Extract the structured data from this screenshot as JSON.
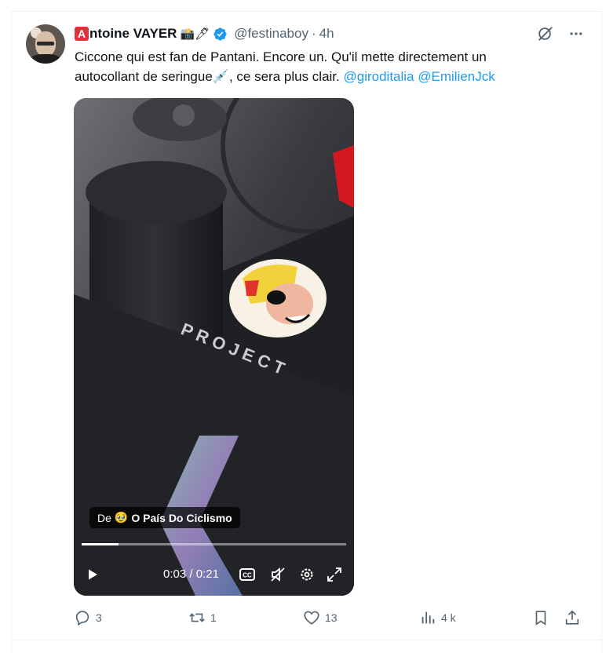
{
  "author": {
    "badge_letter": "A",
    "name": "ntoine VAYER",
    "name_emojis": "📸🖊",
    "handle": "@festinaboy",
    "separator": "·",
    "time": "4h",
    "verified_color": "#1d9bf0"
  },
  "tweet": {
    "text_line1": "Ciccone qui est fan de Pantani. Encore un. Qu'il mette directement un",
    "text_line2": "autocollant de seringue",
    "syringe_emoji": "💉",
    "text_line2_after": ", ce sera plus clair.",
    "mention1": "@giroditalia",
    "mention2": "@EmilienJck"
  },
  "media": {
    "frame_text": "P R O J E C T",
    "source_prefix": "De",
    "source_emoji": "🥹",
    "source_name": "O País Do Ciclismo",
    "progress_fraction": 0.14,
    "current_time": "0:03",
    "time_separator": "/",
    "duration": "0:21"
  },
  "actions": {
    "replies": "3",
    "reposts": "1",
    "likes": "13",
    "views": "4 k"
  },
  "icons": {
    "top": [
      "grok-icon",
      "more-icon"
    ],
    "video": [
      "play-icon",
      "captions-icon",
      "mute-icon",
      "settings-icon",
      "fullscreen-icon"
    ],
    "actions": [
      "reply-icon",
      "repost-icon",
      "like-icon",
      "views-icon",
      "bookmark-icon",
      "share-icon"
    ]
  },
  "colors": {
    "link": "#1d9bf0",
    "secondary_text": "#536471",
    "badge_red": "#e0303a"
  }
}
